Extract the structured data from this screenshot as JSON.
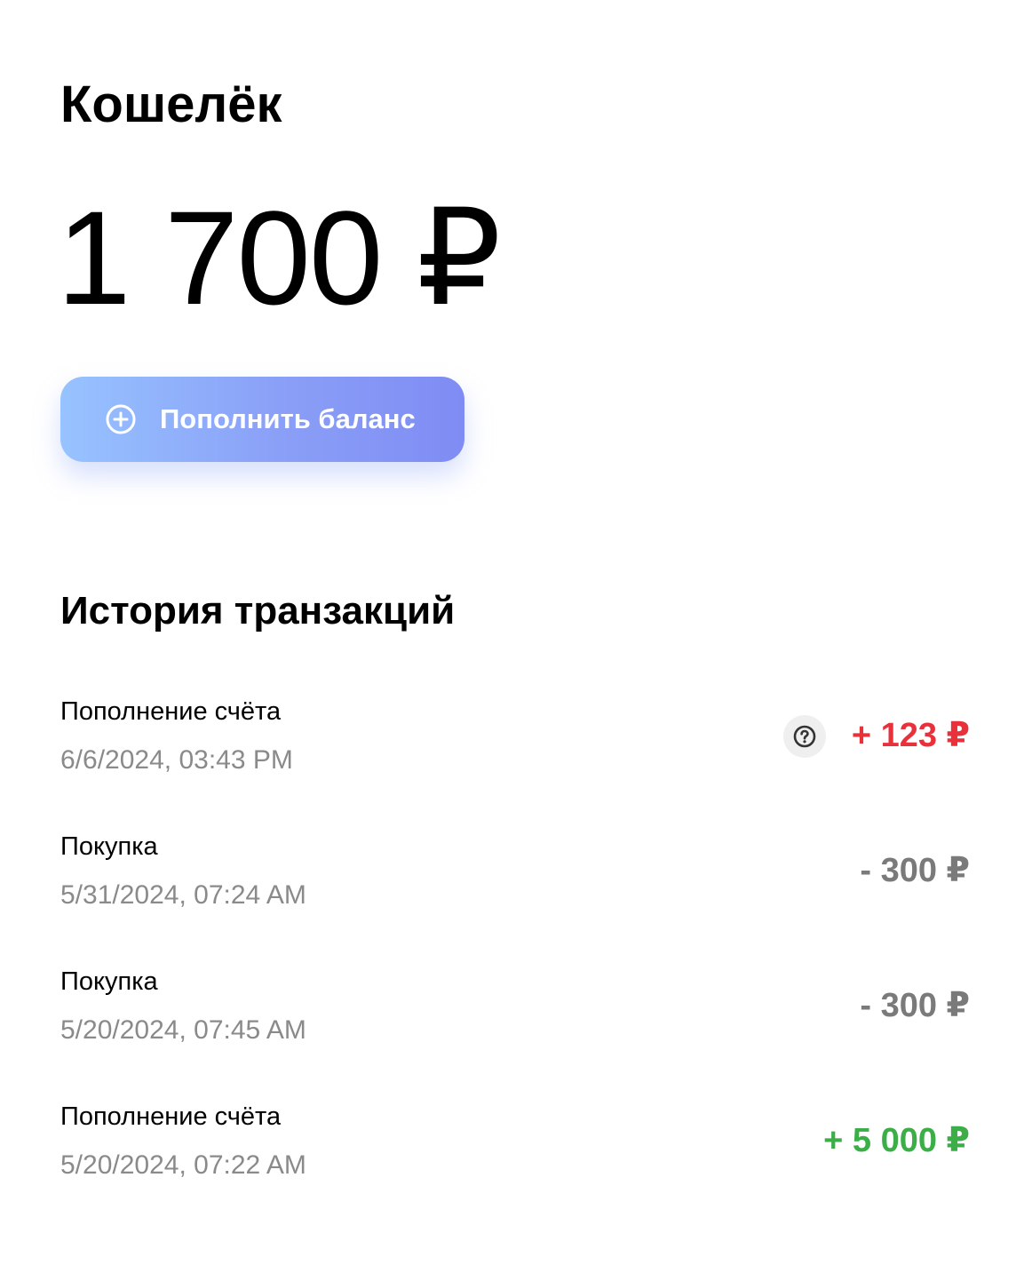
{
  "header": {
    "title": "Кошелёк"
  },
  "balance": {
    "amount": "1 700 ₽"
  },
  "topup": {
    "label": "Пополнить баланс",
    "icon": "plus-circle-icon"
  },
  "history": {
    "title": "История транзакций",
    "items": [
      {
        "name": "Пополнение счёта",
        "date": "6/6/2024, 03:43 PM",
        "amount": "+ 123 ₽",
        "color": "#e8313b",
        "icon": "question-circle-icon"
      },
      {
        "name": "Покупка",
        "date": "5/31/2024, 07:24 AM",
        "amount": "- 300 ₽",
        "color": "#7a7a7a"
      },
      {
        "name": "Покупка",
        "date": "5/20/2024, 07:45 AM",
        "amount": "- 300 ₽",
        "color": "#7a7a7a"
      },
      {
        "name": "Пополнение счёта",
        "date": "5/20/2024, 07:22 AM",
        "amount": "+ 5 000 ₽",
        "color": "#3bae48"
      }
    ]
  }
}
